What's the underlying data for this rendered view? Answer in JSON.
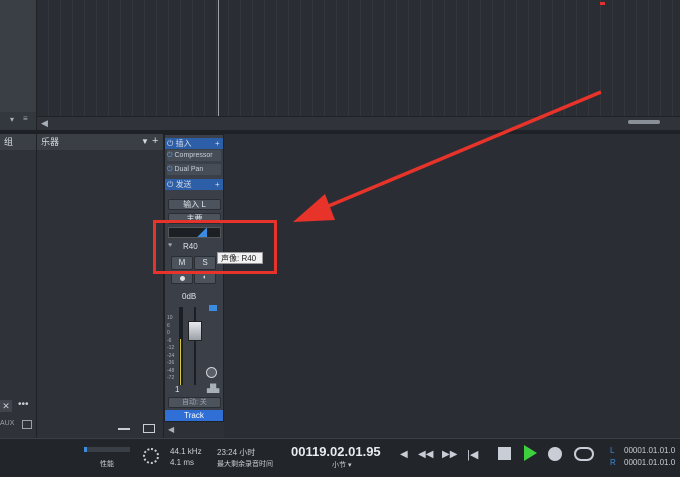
{
  "left_panel": {
    "group_label": "组",
    "aux_label": "AUX"
  },
  "instrument_panel": {
    "header": "乐器"
  },
  "channel": {
    "insert_label": "插入",
    "plugins": [
      "Compressor",
      "Dual Pan"
    ],
    "send_label": "发送",
    "input": "输入 L",
    "output": "主要",
    "pan_value": "R40",
    "mute": "M",
    "solo": "S",
    "gain": "0dB",
    "scale": [
      "10",
      "6",
      "0",
      "-6",
      "-12",
      "-24",
      "-36",
      "-48",
      "-72"
    ],
    "channel_number": "1",
    "auto": "自动: 关",
    "track_name": "Track"
  },
  "tooltip": "声像: R40",
  "transport": {
    "performance_label": "性能",
    "sample_rate": "44.1 kHz",
    "latency": "4.1 ms",
    "record_time": "23:24 小时",
    "record_time_label": "最大剩余录音时间",
    "position": "00119.02.01.95",
    "position_unit": "小节",
    "loop_l_label": "L",
    "loop_r_label": "R",
    "loop_l": "00001.01.01.0",
    "loop_r": "00001.01.01.0"
  },
  "colors": {
    "accent": "#2f6fd6",
    "highlight": "#e8332a",
    "play": "#3ecf3e"
  }
}
